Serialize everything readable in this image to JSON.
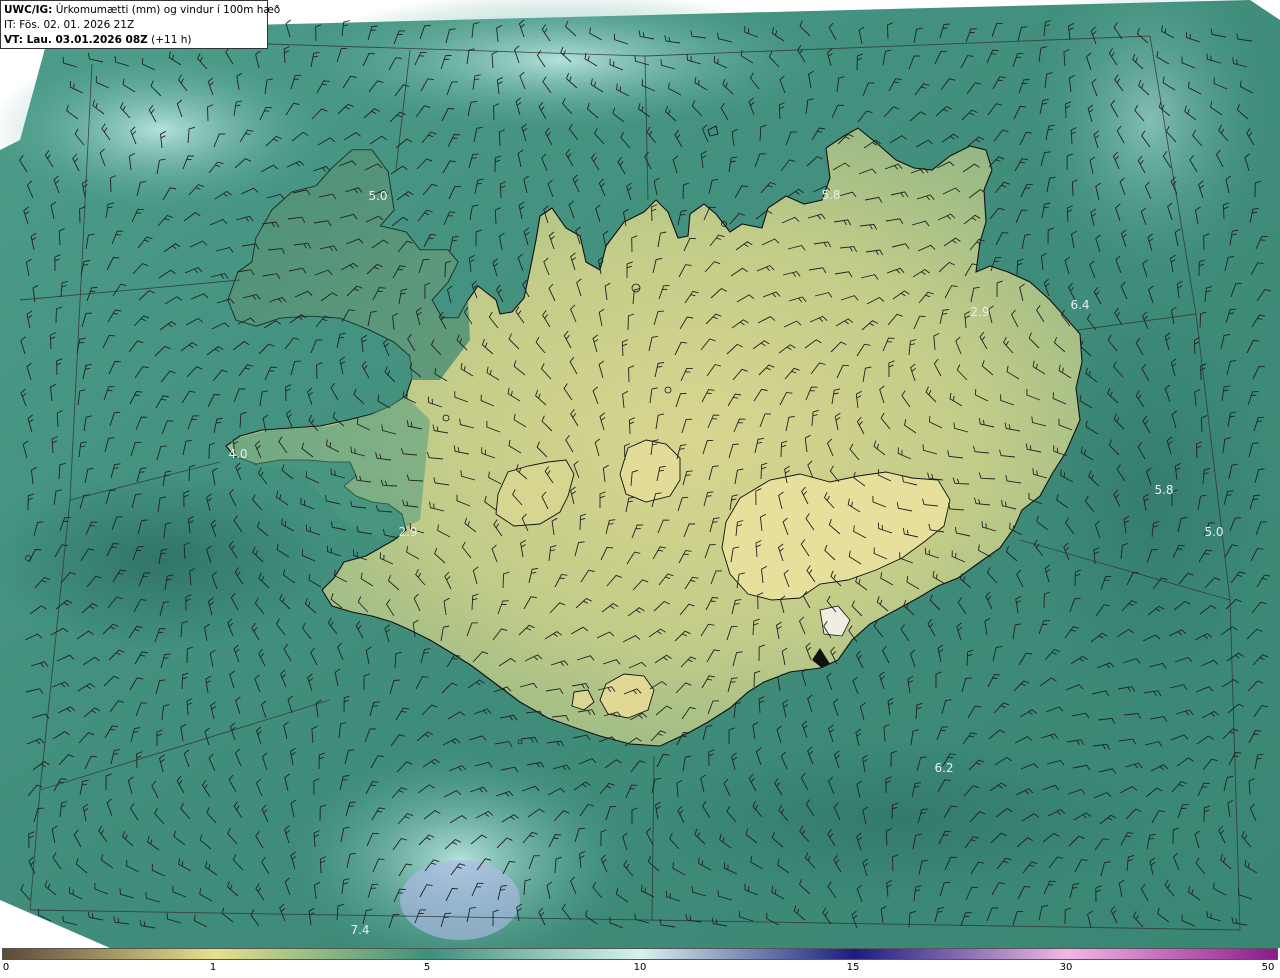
{
  "header": {
    "model": "UWC/IG:",
    "title": " Úrkomumætti (mm) og vindur í 100m hæð",
    "it_line": "IT: Fös. 02. 01. 2026 21Z",
    "vt_prefix": "VT: Lau. 03.01.2026 08Z",
    "vt_suffix": " (+11 h)"
  },
  "colorbar": {
    "ticks": [
      "0",
      "1",
      "5",
      "10",
      "15",
      "30",
      "50"
    ],
    "tick_values": [
      0,
      1,
      5,
      10,
      15,
      30,
      50
    ],
    "stops": [
      {
        "v": 0,
        "color": "#5c4a3a"
      },
      {
        "v": 1,
        "color": "#e6e08c"
      },
      {
        "v": 5,
        "color": "#3e8f7c"
      },
      {
        "v": 10,
        "color": "#d8f2ee"
      },
      {
        "v": 15,
        "color": "#1c1c7e"
      },
      {
        "v": 30,
        "color": "#f0b8e6"
      },
      {
        "v": 50,
        "color": "#8c1a8c"
      }
    ]
  },
  "map_labels": [
    {
      "text": "5.0"
    },
    {
      "text": "5.8"
    },
    {
      "text": "6.4"
    },
    {
      "text": "2.9"
    },
    {
      "text": "4.0"
    },
    {
      "text": "2.9"
    },
    {
      "text": "5.8"
    },
    {
      "text": "5.0"
    },
    {
      "text": "6.2"
    },
    {
      "text": "7.4"
    }
  ]
}
